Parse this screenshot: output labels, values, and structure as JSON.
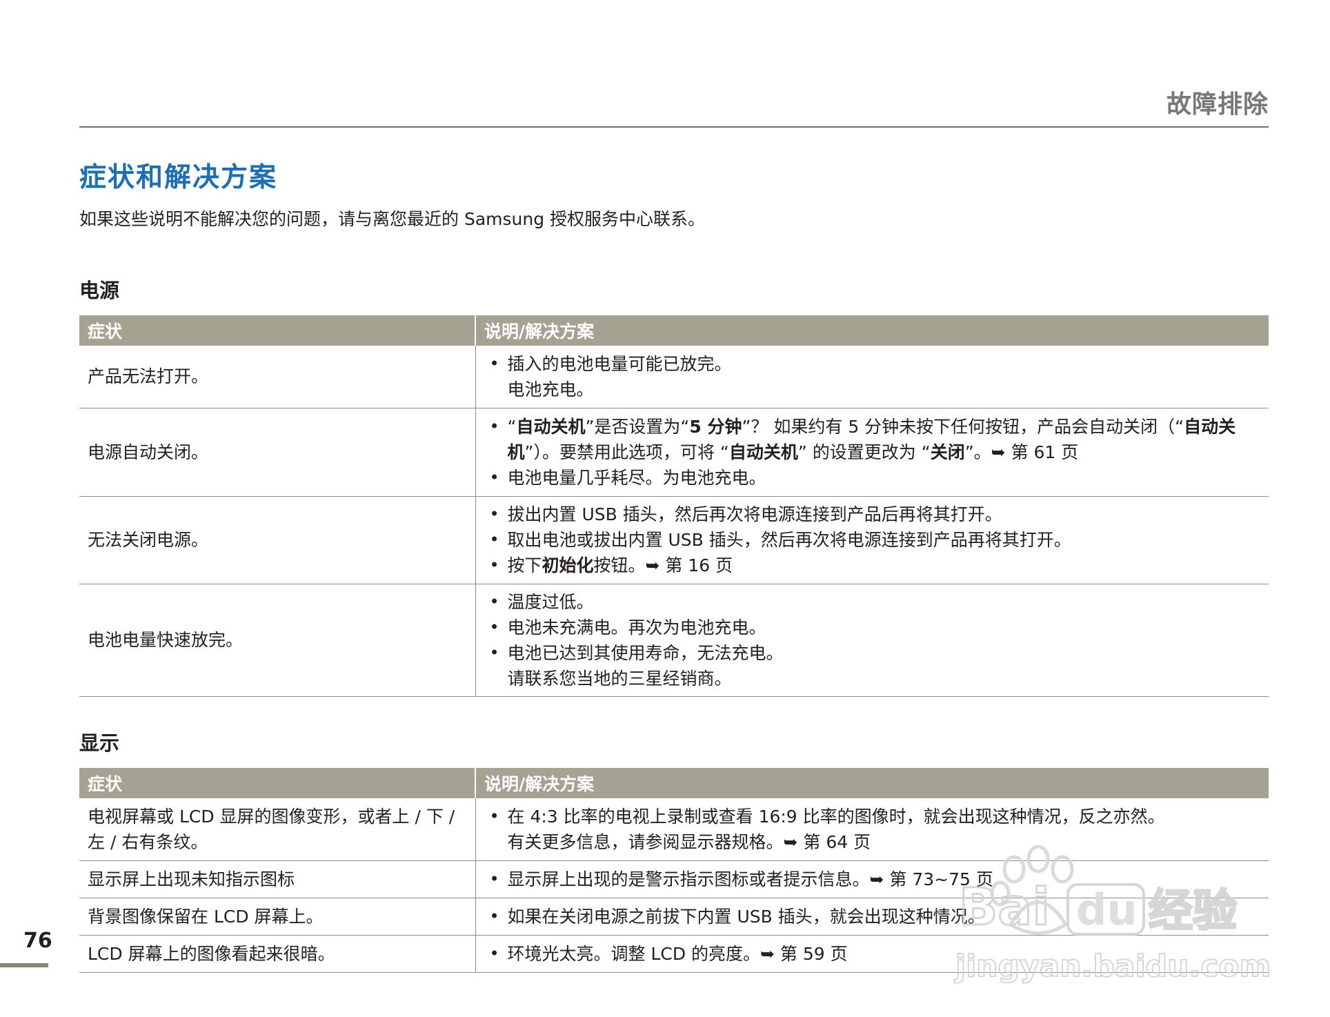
{
  "header": {
    "title": "故障排除"
  },
  "page_title": "症状和解决方案",
  "intro": "如果这些说明不能解决您的问题，请与离您最近的 Samsung 授权服务中心联系。",
  "sections": [
    {
      "title": "电源",
      "col_symptom": "症状",
      "col_solution": "说明/解决方案",
      "rows": [
        {
          "symptom": "产品无法打开。",
          "items": [
            {
              "lines": [
                "插入的电池电量可能已放完。",
                "电池充电。"
              ]
            }
          ]
        },
        {
          "symptom": "电源自动关闭。",
          "items": [
            {
              "parts": [
                "“",
                "自动关机",
                "”是否设置为“",
                "5 分钟",
                "”？ 如果约有 5 分钟未按下任何按钮，产品会自动关闭（“",
                "自动关机",
                "”）。要禁用此选项，可将 “",
                "自动关机",
                "” 的设置更改为 “",
                "关闭",
                "”。➥ 第 61 页"
              ]
            },
            {
              "lines": [
                "电池电量几乎耗尽。为电池充电。"
              ]
            }
          ]
        },
        {
          "symptom": "无法关闭电源。",
          "items": [
            {
              "lines": [
                "拔出内置 USB 插头，然后再次将电源连接到产品后再将其打开。"
              ]
            },
            {
              "lines": [
                "取出电池或拔出内置 USB 插头，然后再次将电源连接到产品再将其打开。"
              ]
            },
            {
              "parts": [
                "按下",
                "初始化",
                "按钮。➥ 第 16 页"
              ]
            }
          ]
        },
        {
          "symptom": "电池电量快速放完。",
          "items": [
            {
              "lines": [
                "温度过低。"
              ]
            },
            {
              "lines": [
                "电池未充满电。再次为电池充电。"
              ]
            },
            {
              "lines": [
                "电池已达到其使用寿命，无法充电。",
                "请联系您当地的三星经销商。"
              ]
            }
          ]
        }
      ]
    },
    {
      "title": "显示",
      "col_symptom": "症状",
      "col_solution": "说明/解决方案",
      "rows": [
        {
          "symptom": "电视屏幕或 LCD 显屏的图像变形，或者上 / 下 / 左 / 右有条纹。",
          "items": [
            {
              "lines": [
                "在 4:3 比率的电视上录制或查看 16:9 比率的图像时，就会出现这种情况，反之亦然。",
                "有关更多信息，请参阅显示器规格。➥ 第 64 页"
              ]
            }
          ]
        },
        {
          "symptom": "显示屏上出现未知指示图标",
          "items": [
            {
              "lines": [
                "显示屏上出现的是警示指示图标或者提示信息。➥ 第 73~75 页"
              ]
            }
          ]
        },
        {
          "symptom": "背景图像保留在 LCD 屏幕上。",
          "items": [
            {
              "lines": [
                "如果在关闭电源之前拔下内置 USB 插头，就会出现这种情况。"
              ]
            }
          ]
        },
        {
          "symptom": "LCD 屏幕上的图像看起来很暗。",
          "items": [
            {
              "lines": [
                "环境光太亮。调整 LCD 的亮度。➥ 第 59 页"
              ]
            }
          ]
        }
      ]
    }
  ],
  "page_number": "76",
  "watermark": {
    "logo": "Baidu经验",
    "url": "jingyan.baidu.com"
  }
}
